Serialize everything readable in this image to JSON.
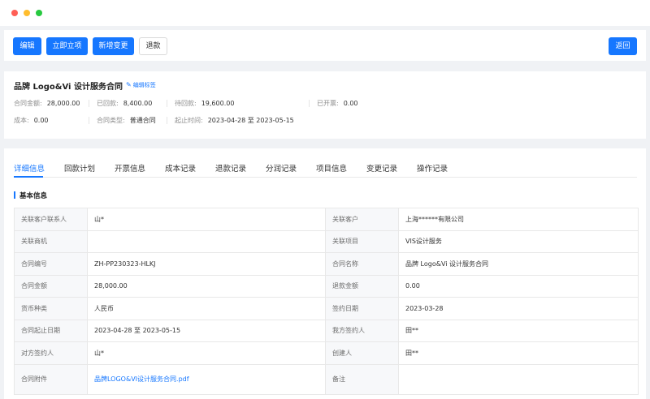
{
  "toolbar": {
    "edit": "编辑",
    "approve": "立即立项",
    "add_change": "新增变更",
    "refund": "退款",
    "back": "返回"
  },
  "summary": {
    "title": "品牌 Logo&Vi 设计服务合同",
    "edit_tag": "编辑标签",
    "amount_label": "合同金额:",
    "amount": "28,000.00",
    "received_label": "已回款:",
    "received": "8,400.00",
    "pending_label": "待回款:",
    "pending": "19,600.00",
    "invoiced_label": "已开票:",
    "invoiced": "0.00",
    "cost_label": "成本:",
    "cost": "0.00",
    "type_label": "合同类型:",
    "type": "普通合同",
    "period_label": "起止时间:",
    "period": "2023-04-28 至 2023-05-15"
  },
  "tabs": [
    "详细信息",
    "回款计划",
    "开票信息",
    "成本记录",
    "退款记录",
    "分润记录",
    "项目信息",
    "变更记录",
    "操作记录"
  ],
  "section_title": "基本信息",
  "table": [
    {
      "l1": "关联客户联系人",
      "v1": "山*",
      "l2": "关联客户",
      "v2": "上海******有限公司"
    },
    {
      "l1": "关联商机",
      "v1": "",
      "l2": "关联项目",
      "v2": "VIS设计服务"
    },
    {
      "l1": "合同编号",
      "v1": "ZH-PP230323-HLKJ",
      "l2": "合同名称",
      "v2": "品牌 Logo&Vi 设计服务合同"
    },
    {
      "l1": "合同金额",
      "v1": "28,000.00",
      "l2": "退款金额",
      "v2": "0.00"
    },
    {
      "l1": "货币种类",
      "v1": "人民币",
      "l2": "签约日期",
      "v2": "2023-03-28"
    },
    {
      "l1": "合同起止日期",
      "v1": "2023-04-28 至 2023-05-15",
      "l2": "我方签约人",
      "v2": "田**"
    },
    {
      "l1": "对方签约人",
      "v1": "山*",
      "l2": "创建人",
      "v2": "田**"
    },
    {
      "l1": "合同附件",
      "v1": "品牌LOGO&VI设计服务合同.pdf",
      "l2": "备注",
      "v2": ""
    }
  ]
}
